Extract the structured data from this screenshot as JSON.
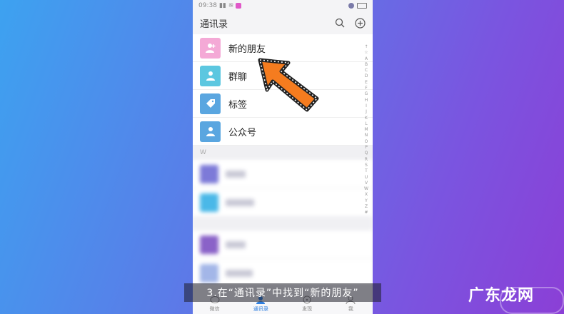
{
  "status": {
    "time": "09:38"
  },
  "header": {
    "title": "通讯录"
  },
  "rows": [
    {
      "label": "新的朋友",
      "color": "#f4a9d6"
    },
    {
      "label": "群聊",
      "color": "#5cc7e0"
    },
    {
      "label": "标签",
      "color": "#5aa6e0"
    },
    {
      "label": "公众号",
      "color": "#5aa6e0"
    }
  ],
  "section_letter": "W",
  "index_letters": [
    "↑",
    "☆",
    "A",
    "B",
    "C",
    "D",
    "E",
    "F",
    "G",
    "H",
    "I",
    "J",
    "K",
    "L",
    "M",
    "N",
    "O",
    "P",
    "Q",
    "R",
    "S",
    "T",
    "U",
    "V",
    "W",
    "X",
    "Y",
    "Z",
    "#"
  ],
  "tabs": [
    {
      "label": "微信",
      "active": false
    },
    {
      "label": "通讯录",
      "active": true
    },
    {
      "label": "发现",
      "active": false
    },
    {
      "label": "我",
      "active": false
    }
  ],
  "caption": "3.在“通讯录”中找到“新的朋友”",
  "watermark": "广东龙网",
  "colors": {
    "accent": "#2e7fe0",
    "arrow": "#f57c1f"
  }
}
